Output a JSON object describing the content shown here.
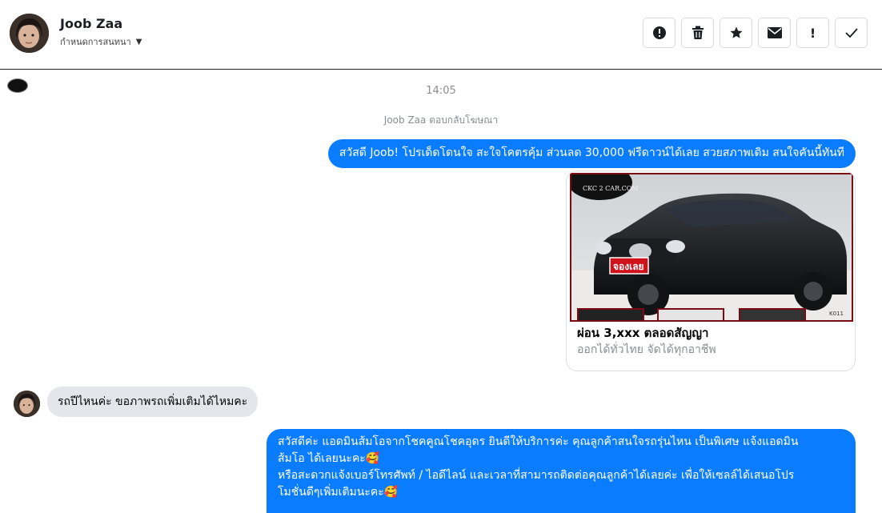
{
  "contact": {
    "name": "Joob Zaa",
    "subtitle": "กำหนดการสนทนา"
  },
  "toolbar": {
    "buttons": [
      {
        "name": "report-button",
        "icon": "alert-circle-icon",
        "glyph": "!"
      },
      {
        "name": "delete-button",
        "icon": "trash-icon",
        "glyph": "🗑"
      },
      {
        "name": "star-button",
        "icon": "star-icon",
        "glyph": "★"
      },
      {
        "name": "mark-unread-button",
        "icon": "mail-icon",
        "glyph": "✉"
      },
      {
        "name": "important-button",
        "icon": "exclamation-icon",
        "glyph": "!"
      },
      {
        "name": "done-button",
        "icon": "check-icon",
        "glyph": "✓"
      }
    ]
  },
  "thread": {
    "timestamp": "14:05",
    "reply_note": "Joob Zaa ตอบกลับโฆษณา",
    "msg_out_1": "สวัสดี Joob! โปรเด็ดโดนใจ สะใจโคตรคุ้ม ส่วนลด 30,000 ฟรีดาวน์ได้เลย สวยสภาพเดิม สนใจคันนี้ทันที",
    "ad": {
      "image_brand": "CKC 2 CAR.COM",
      "image_badge": "จองเลย",
      "image_code": "K011",
      "title": "ผ่อน 3,xxx ตลอดสัญญา",
      "subtitle": "ออกได้ทั่วไทย จัดได้ทุกอาชีพ"
    },
    "msg_in_1": "รถปีไหนค่ะ ขอภาพรถเพิ่มเติมได้ไหมคะ",
    "msg_out_2_line1": "สวัสดีค่ะ แอดมินส้มโอจากโชคคูณโชคอุดร ยินดีให้บริการค่ะ   คุณลูกค้าสนใจรถรุ่นไหน เป็นพิเศษ แจ้งแอดมิน",
    "msg_out_2_line2": "ส้มโอ ได้เลยนะคะ🥰",
    "msg_out_2_line3": "หรือสะดวกแจ้งเบอร์โทรศัพท์ / ไอดีไลน์ และเวลาที่สามารถติดต่อคุณลูกค้าได้เลยค่ะ เพื่อให้เซลล์ได้เสนอโปร",
    "msg_out_2_line4": "โมชั่นดีๆเพิ่มเติมนะคะ🥰"
  },
  "colors": {
    "outgoing_bubble": "#0a7cff",
    "incoming_bubble": "#e4e6eb",
    "meta_text": "#8a8d91"
  }
}
